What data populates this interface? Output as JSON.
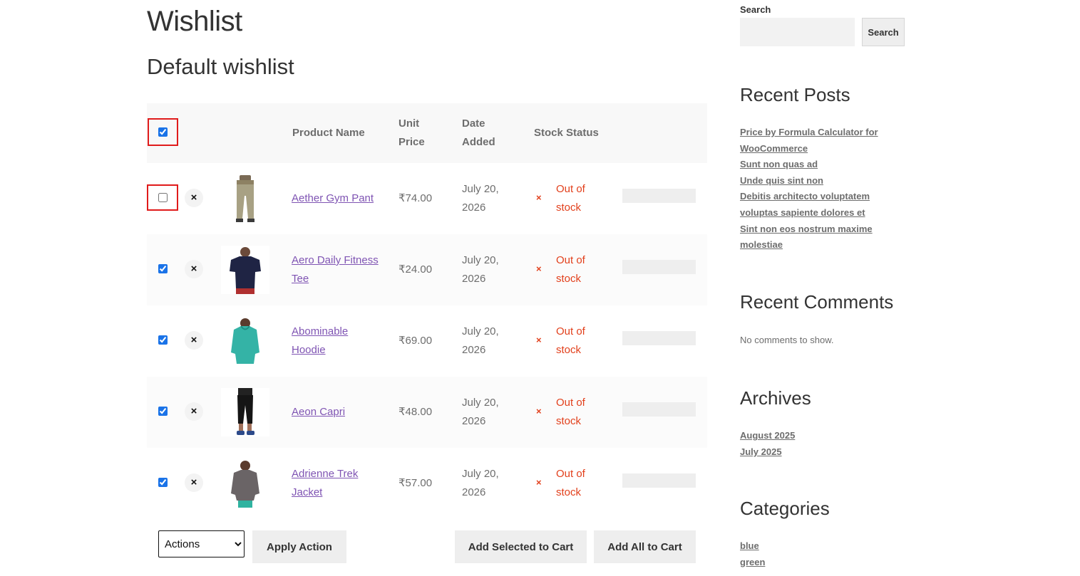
{
  "page": {
    "title": "Wishlist",
    "list_title": "Default wishlist"
  },
  "table": {
    "headers": {
      "product_name": "Product Name",
      "unit_price": "Unit Price",
      "date_added": "Date Added",
      "stock_status": "Stock Status"
    },
    "select_all_checked": true,
    "rows": [
      {
        "name": "Aether Gym Pant",
        "price": "₹74.00",
        "date": "July 20, 2026",
        "stock": "Out of stock",
        "checked": false,
        "image": "pants-thumbnail"
      },
      {
        "name": "Aero Daily Fitness Tee",
        "price": "₹24.00",
        "date": "July 20, 2026",
        "stock": "Out of stock",
        "checked": true,
        "image": "tee-thumbnail"
      },
      {
        "name": "Abominable Hoodie",
        "price": "₹69.00",
        "date": "July 20, 2026",
        "stock": "Out of stock",
        "checked": true,
        "image": "hoodie-thumbnail"
      },
      {
        "name": "Aeon Capri",
        "price": "₹48.00",
        "date": "July 20, 2026",
        "stock": "Out of stock",
        "checked": true,
        "image": "capri-thumbnail"
      },
      {
        "name": "Adrienne Trek Jacket",
        "price": "₹57.00",
        "date": "July 20, 2026",
        "stock": "Out of stock",
        "checked": true,
        "image": "jacket-thumbnail"
      }
    ],
    "remove_glyph": "×",
    "stock_glyph": "×"
  },
  "footer": {
    "actions_selected": "Actions",
    "apply_label": "Apply Action",
    "add_selected_label": "Add Selected to Cart",
    "add_all_label": "Add All to Cart"
  },
  "sidebar": {
    "search_label": "Search",
    "search_button": "Search",
    "search_value": "",
    "recent_posts_title": "Recent Posts",
    "recent_posts": [
      "Price by Formula Calculator for WooCommerce",
      "Sunt non quas ad",
      "Unde quis sint non",
      "Debitis architecto voluptatem voluptas sapiente dolores et",
      "Sint non eos nostrum maxime molestiae"
    ],
    "recent_comments_title": "Recent Comments",
    "no_comments": "No comments to show.",
    "archives_title": "Archives",
    "archives": [
      "August 2025",
      "July 2025"
    ],
    "categories_title": "Categories",
    "categories": [
      "blue",
      "green"
    ]
  },
  "colors": {
    "link": "#7f54b3",
    "out_of_stock": "#e2401c",
    "highlight": "#e01b1b",
    "checkbox": "#1a73e8"
  }
}
